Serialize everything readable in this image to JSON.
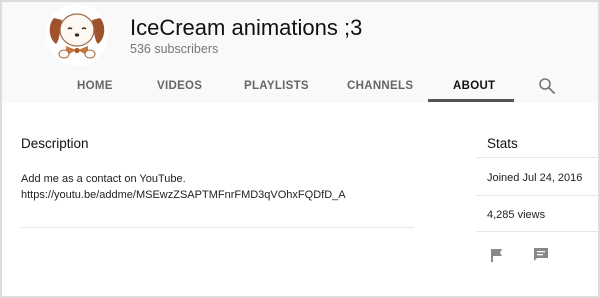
{
  "channel": {
    "name": "IceCream animations ;3",
    "subscribers": "536 subscribers",
    "avatar_icon": "puppy-avatar-icon"
  },
  "tabs": [
    {
      "label": "HOME",
      "active": false
    },
    {
      "label": "VIDEOS",
      "active": false
    },
    {
      "label": "PLAYLISTS",
      "active": false
    },
    {
      "label": "CHANNELS",
      "active": false
    },
    {
      "label": "ABOUT",
      "active": true
    }
  ],
  "search": {
    "icon": "search-icon"
  },
  "description": {
    "title": "Description",
    "text": "Add me as a contact on YouTube.\nhttps://youtu.be/addme/MSEwzZSAPTMFnrFMD3qVOhxFQDfD_A"
  },
  "stats": {
    "title": "Stats",
    "joined": "Joined Jul 24, 2016",
    "views": "4,285 views"
  },
  "actions": {
    "flag_icon": "flag-icon",
    "message_icon": "message-icon"
  },
  "colors": {
    "header_bg": "#f9f9f9",
    "active_underline": "#555555",
    "tab_text": "#666666"
  }
}
